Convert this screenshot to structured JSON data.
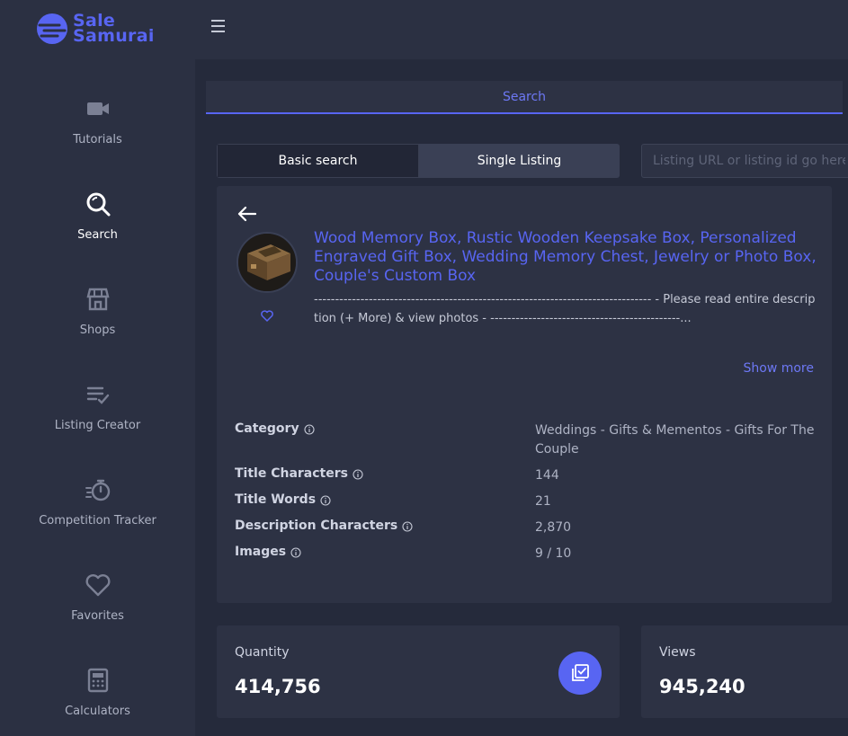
{
  "brand": {
    "line1": "Sale",
    "line2": "Samurai"
  },
  "sidebar": {
    "items": [
      {
        "label": "Tutorials",
        "icon": "video-camera-icon"
      },
      {
        "label": "Search",
        "icon": "search-icon",
        "active": true
      },
      {
        "label": "Shops",
        "icon": "shop-icon"
      },
      {
        "label": "Listing Creator",
        "icon": "list-check-icon"
      },
      {
        "label": "Competition Tracker",
        "icon": "stopwatch-icon"
      },
      {
        "label": "Favorites",
        "icon": "heart-icon"
      },
      {
        "label": "Calculators",
        "icon": "calculator-icon"
      }
    ]
  },
  "tabs": {
    "search": "Search"
  },
  "search_mode": {
    "basic": "Basic search",
    "single": "Single Listing"
  },
  "url_input": {
    "placeholder": "Listing URL or listing id go here",
    "value": ""
  },
  "listing": {
    "title": "Wood Memory Box, Rustic Wooden Keepsake Box, Personalized Engraved Gift Box, Wedding Memory Chest, Jewelry or Photo Box, Couple's Custom Box",
    "description": "-------------------------------------------------------------------------------- - Please read entire description (+ More) & view photos - ---------------------------------------------...",
    "show_more": "Show more"
  },
  "properties": [
    {
      "label": "Category",
      "value": "Weddings - Gifts & Mementos - Gifts For The Couple"
    },
    {
      "label": "Title Characters",
      "value": "144"
    },
    {
      "label": "Title Words",
      "value": "21"
    },
    {
      "label": "Description Characters",
      "value": "2,870"
    },
    {
      "label": "Images",
      "value": "9 / 10"
    }
  ],
  "stats": {
    "quantity": {
      "label": "Quantity",
      "value": "414,756"
    },
    "views": {
      "label": "Views",
      "value": "945,240"
    }
  },
  "colors": {
    "accent": "#5865f2",
    "background": "#252a3b",
    "panel": "#2d3244",
    "sidebar": "#2b3042"
  }
}
